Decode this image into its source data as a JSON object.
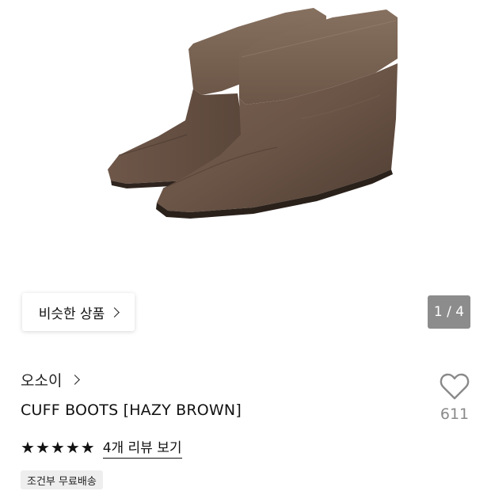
{
  "product_image": {
    "current_page": 1,
    "total_pages": 4,
    "pager_label": "1 / 4",
    "boot_color": "#6a5548"
  },
  "similar_products": {
    "label": "비슷한 상품"
  },
  "product": {
    "brand": "오소이",
    "title": "CUFF BOOTS [HAZY BROWN]",
    "rating_stars": 5,
    "review_link": "4개 리뷰 보기",
    "shipping_badge": "조건부 무료배송",
    "like_count": "611"
  }
}
